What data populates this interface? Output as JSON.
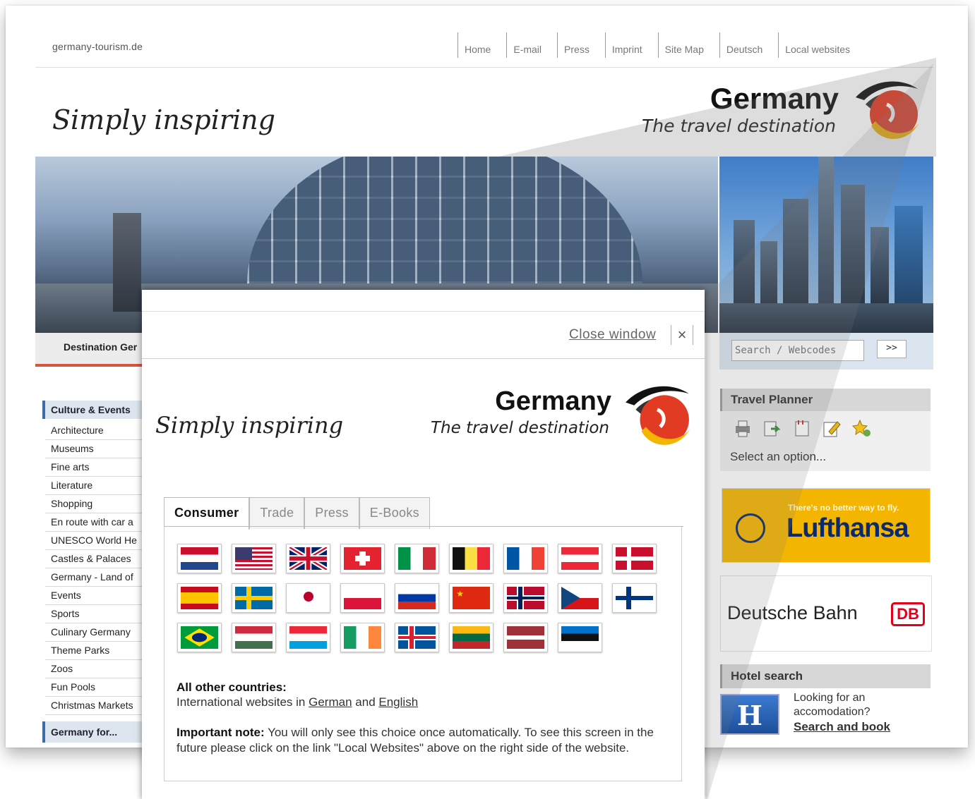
{
  "site": {
    "url": "germany-tourism.de",
    "nav": [
      "Home",
      "E-mail",
      "Press",
      "Imprint",
      "Site Map",
      "Deutsch",
      "Local websites"
    ],
    "tagline": "Simply inspiring",
    "logo_title": "Germany",
    "logo_subtitle": "The travel destination",
    "destination_tab": "Destination Ger",
    "search_placeholder": "Search / Webcodes",
    "search_button": ">>",
    "sidebar": {
      "heading": "Culture & Events",
      "items": [
        "Architecture",
        "Museums",
        "Fine arts",
        "Literature",
        "Shopping",
        "En route with car a",
        "UNESCO World He",
        "Castles & Palaces",
        "Germany - Land of",
        "Events",
        "Sports",
        "Culinary Germany",
        "Theme Parks",
        "Zoos",
        "Fun Pools",
        "Christmas Markets"
      ],
      "footer": "Germany for..."
    },
    "travel_planner": {
      "heading": "Travel Planner",
      "icons": [
        "print-icon",
        "export-icon",
        "note-icon",
        "edit-icon",
        "favorites-icon"
      ],
      "select": "Select an option..."
    },
    "lufthansa": {
      "tagline": "There's no better way to fly.",
      "name": "Lufthansa"
    },
    "db": {
      "name": "Deutsche Bahn",
      "logo": "DB"
    },
    "hotel": {
      "heading": "Hotel search",
      "icon_letter": "H",
      "text": "Looking for an accomodation?",
      "link": "Search and book"
    }
  },
  "popup": {
    "close_label": "Close window",
    "close_icon": "×",
    "tagline": "Simply inspiring",
    "logo_title": "Germany",
    "logo_subtitle": "The travel destination",
    "tabs": [
      "Consumer",
      "Trade",
      "Press",
      "E-Books"
    ],
    "active_tab": "Consumer",
    "flags": [
      "netherlands",
      "usa",
      "uk",
      "switzerland",
      "italy",
      "belgium",
      "france",
      "austria",
      "denmark",
      "spain",
      "sweden",
      "japan",
      "poland",
      "russia",
      "china",
      "norway",
      "czech",
      "finland",
      "brazil",
      "hungary",
      "luxembourg",
      "ireland",
      "iceland",
      "lithuania",
      "latvia",
      "estonia"
    ],
    "other_label": "All other countries:",
    "other_prefix": "International websites in",
    "other_link_german": "German",
    "other_and": "and",
    "other_link_english": "English",
    "note_label": "Important note:",
    "note_text": "You will only see this choice once automatically. To see this screen in the future please click on the link \"Local Websites\" above on the right side of the website."
  },
  "colors": {
    "accent_red": "#d8553d",
    "nav_blue": "#3c6ea5",
    "lufthansa_yellow": "#f4b500",
    "db_red": "#e2001a"
  }
}
